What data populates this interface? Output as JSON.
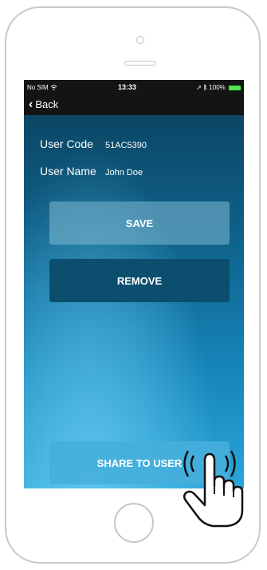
{
  "status_bar": {
    "carrier": "No SIM",
    "time": "13:33",
    "battery": "100%"
  },
  "nav": {
    "back_label": "Back"
  },
  "user": {
    "code_label": "User Code",
    "code_value": "51AC5390",
    "name_label": "User Name",
    "name_value": "John Doe"
  },
  "buttons": {
    "save_label": "SAVE",
    "remove_label": "REMOVE",
    "share_label": "SHARE TO USER"
  },
  "icons": [
    "wifi-icon",
    "location-arrow-icon",
    "bluetooth-icon",
    "battery-icon",
    "back-chevron-icon",
    "tapping-hand-icon"
  ],
  "colors": {
    "status_bar_bg": "#141414",
    "remove_bg": "#0c4e6e",
    "share_bg": "#46afdc",
    "battery": "#4ee54e"
  }
}
